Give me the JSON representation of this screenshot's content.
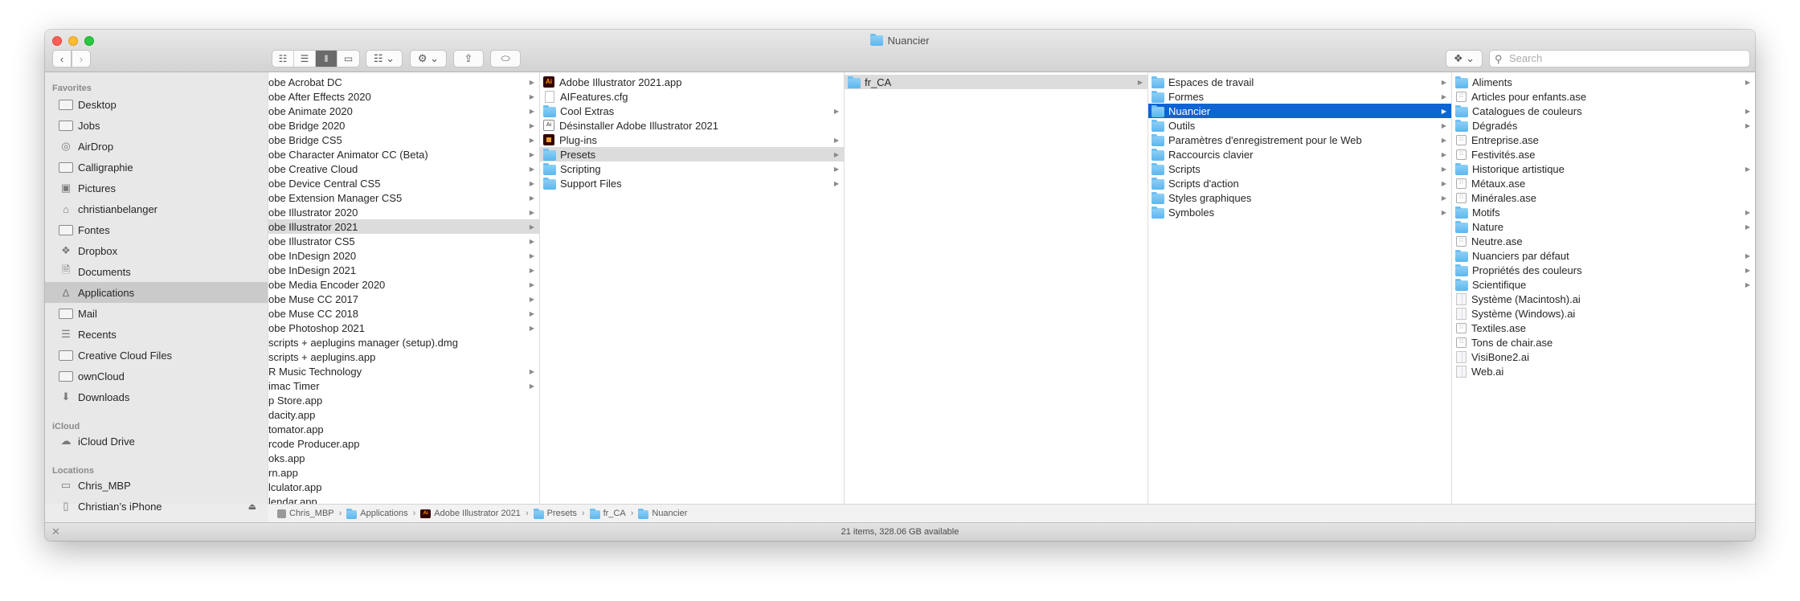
{
  "window": {
    "title": "Nuancier"
  },
  "toolbar": {
    "search_placeholder": "Search"
  },
  "sidebar": {
    "favorites_header": "Favorites",
    "favorites": [
      {
        "label": "Desktop",
        "icon": "desktop-icon"
      },
      {
        "label": "Jobs",
        "icon": "folder-icon"
      },
      {
        "label": "AirDrop",
        "icon": "airdrop-icon"
      },
      {
        "label": "Calligraphie",
        "icon": "folder-icon"
      },
      {
        "label": "Pictures",
        "icon": "camera-icon"
      },
      {
        "label": "christianbelanger",
        "icon": "home-icon"
      },
      {
        "label": "Fontes",
        "icon": "folder-icon"
      },
      {
        "label": "Dropbox",
        "icon": "dropbox-icon"
      },
      {
        "label": "Documents",
        "icon": "document-icon"
      },
      {
        "label": "Applications",
        "icon": "applications-icon",
        "selected": true
      },
      {
        "label": "Mail",
        "icon": "folder-icon"
      },
      {
        "label": "Recents",
        "icon": "recents-icon"
      },
      {
        "label": "Creative Cloud Files",
        "icon": "folder-icon"
      },
      {
        "label": "ownCloud",
        "icon": "folder-icon"
      },
      {
        "label": "Downloads",
        "icon": "downloads-icon"
      }
    ],
    "icloud_header": "iCloud",
    "icloud": [
      {
        "label": "iCloud Drive",
        "icon": "cloud-icon"
      }
    ],
    "locations_header": "Locations",
    "locations": [
      {
        "label": "Chris_MBP",
        "icon": "laptop-icon"
      },
      {
        "label": "Christian’s iPhone",
        "icon": "iphone-icon",
        "eject": true
      }
    ]
  },
  "columns": [
    {
      "items": [
        {
          "label": "obe Acrobat DC",
          "arrow": true
        },
        {
          "label": "obe After Effects 2020",
          "arrow": true
        },
        {
          "label": "obe Animate 2020",
          "arrow": true
        },
        {
          "label": "obe Bridge 2020",
          "arrow": true
        },
        {
          "label": "obe Bridge CS5",
          "arrow": true
        },
        {
          "label": "obe Character Animator CC (Beta)",
          "arrow": true
        },
        {
          "label": "obe Creative Cloud",
          "arrow": true
        },
        {
          "label": "obe Device Central CS5",
          "arrow": true
        },
        {
          "label": "obe Extension Manager CS5",
          "arrow": true
        },
        {
          "label": "obe Illustrator 2020",
          "arrow": true
        },
        {
          "label": "obe Illustrator 2021",
          "arrow": true,
          "state": "gray"
        },
        {
          "label": "obe Illustrator CS5",
          "arrow": true
        },
        {
          "label": "obe InDesign 2020",
          "arrow": true
        },
        {
          "label": "obe InDesign 2021",
          "arrow": true
        },
        {
          "label": "obe Media Encoder 2020",
          "arrow": true
        },
        {
          "label": "obe Muse CC 2017",
          "arrow": true
        },
        {
          "label": "obe Muse CC 2018",
          "arrow": true
        },
        {
          "label": "obe Photoshop 2021",
          "arrow": true
        },
        {
          "label": "scripts + aeplugins manager (setup).dmg"
        },
        {
          "label": "scripts + aeplugins.app"
        },
        {
          "label": "R Music Technology",
          "arrow": true
        },
        {
          "label": "imac Timer",
          "arrow": true
        },
        {
          "label": "p Store.app"
        },
        {
          "label": "dacity.app"
        },
        {
          "label": "tomator.app"
        },
        {
          "label": "rcode Producer.app"
        },
        {
          "label": "oks.app"
        },
        {
          "label": "rn.app"
        },
        {
          "label": "lculator.app"
        },
        {
          "label": "lendar.app"
        }
      ]
    },
    {
      "items": [
        {
          "label": "Adobe Illustrator 2021.app",
          "icon": "app"
        },
        {
          "label": "AIFeatures.cfg",
          "icon": "file"
        },
        {
          "label": "Cool Extras",
          "icon": "folder",
          "arrow": true
        },
        {
          "label": "Désinstaller Adobe Illustrator 2021",
          "icon": "uninst"
        },
        {
          "label": "Plug-ins",
          "icon": "plug",
          "arrow": true
        },
        {
          "label": "Presets",
          "icon": "folder",
          "arrow": true,
          "state": "gray"
        },
        {
          "label": "Scripting",
          "icon": "folder",
          "arrow": true
        },
        {
          "label": "Support Files",
          "icon": "folder",
          "arrow": true
        }
      ]
    },
    {
      "items": [
        {
          "label": "fr_CA",
          "icon": "folder",
          "arrow": true,
          "state": "gray"
        }
      ]
    },
    {
      "items": [
        {
          "label": "Espaces de travail",
          "icon": "folder",
          "arrow": true
        },
        {
          "label": "Formes",
          "icon": "folder",
          "arrow": true
        },
        {
          "label": "Nuancier",
          "icon": "folder",
          "arrow": true,
          "state": "blue"
        },
        {
          "label": "Outils",
          "icon": "folder",
          "arrow": true
        },
        {
          "label": "Paramètres d'enregistrement pour le Web",
          "icon": "folder",
          "arrow": true
        },
        {
          "label": "Raccourcis clavier",
          "icon": "folder",
          "arrow": true
        },
        {
          "label": "Scripts",
          "icon": "folder",
          "arrow": true
        },
        {
          "label": "Scripts d'action",
          "icon": "folder",
          "arrow": true
        },
        {
          "label": "Styles graphiques",
          "icon": "folder",
          "arrow": true
        },
        {
          "label": "Symboles",
          "icon": "folder",
          "arrow": true
        }
      ]
    },
    {
      "items": [
        {
          "label": "Aliments",
          "icon": "folder",
          "arrow": true
        },
        {
          "label": "Articles pour enfants.ase",
          "icon": "ase"
        },
        {
          "label": "Catalogues de couleurs",
          "icon": "folder",
          "arrow": true
        },
        {
          "label": "Dégradés",
          "icon": "folder",
          "arrow": true
        },
        {
          "label": "Entreprise.ase",
          "icon": "ase"
        },
        {
          "label": "Festivités.ase",
          "icon": "ase"
        },
        {
          "label": "Historique artistique",
          "icon": "folder",
          "arrow": true
        },
        {
          "label": "Métaux.ase",
          "icon": "ase"
        },
        {
          "label": "Minérales.ase",
          "icon": "ase"
        },
        {
          "label": "Motifs",
          "icon": "folder",
          "arrow": true
        },
        {
          "label": "Nature",
          "icon": "folder",
          "arrow": true
        },
        {
          "label": "Neutre.ase",
          "icon": "ase"
        },
        {
          "label": "Nuanciers par défaut",
          "icon": "folder",
          "arrow": true
        },
        {
          "label": "Propriétés des couleurs",
          "icon": "folder",
          "arrow": true
        },
        {
          "label": "Scientifique",
          "icon": "folder",
          "arrow": true
        },
        {
          "label": "Système (Macintosh).ai",
          "icon": "aidoc"
        },
        {
          "label": "Système (Windows).ai",
          "icon": "aidoc"
        },
        {
          "label": "Textiles.ase",
          "icon": "ase"
        },
        {
          "label": "Tons de chair.ase",
          "icon": "ase"
        },
        {
          "label": "VisiBone2.ai",
          "icon": "aidoc"
        },
        {
          "label": "Web.ai",
          "icon": "aidoc"
        }
      ]
    }
  ],
  "pathbar": [
    {
      "label": "Chris_MBP",
      "icon": "disk"
    },
    {
      "label": "Applications",
      "icon": "appsfolder"
    },
    {
      "label": "Adobe Illustrator 2021",
      "icon": "app"
    },
    {
      "label": "Presets",
      "icon": "folder"
    },
    {
      "label": "fr_CA",
      "icon": "folder"
    },
    {
      "label": "Nuancier",
      "icon": "folder"
    }
  ],
  "status": {
    "text": "21 items, 328.06 GB available"
  }
}
